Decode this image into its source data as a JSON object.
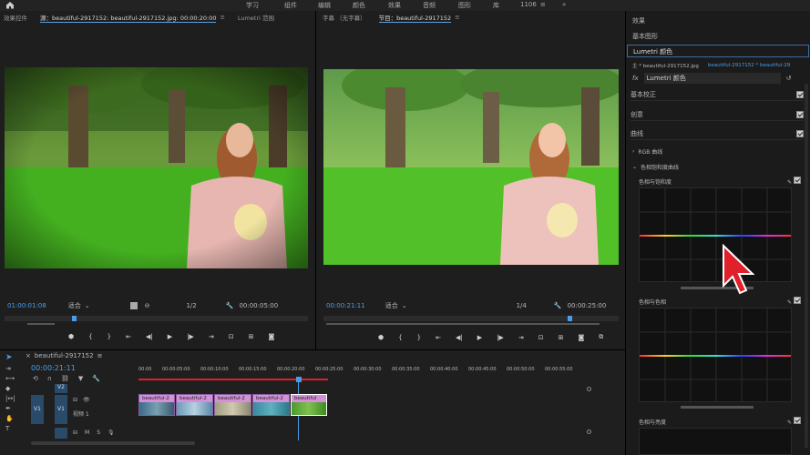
{
  "workspaces": [
    "学习",
    "组件",
    "编辑",
    "颜色",
    "效果",
    "音频",
    "图形",
    "库"
  ],
  "workspace_count": "1106",
  "source_monitor": {
    "tabs": [
      "效果控件",
      "源：beautiful-2917152: beautiful-2917152.jpg: 00:00:20:00",
      "Lumetri 范围"
    ],
    "timecode": "01:00:01:08",
    "fit": "适合",
    "resolution": "1/2",
    "duration": "00:00:05:00"
  },
  "program_monitor": {
    "tabs": [
      "字幕 （无字幕）",
      "节目：beautiful-2917152"
    ],
    "timecode": "00:00:21:11",
    "fit": "适合",
    "resolution": "1/4",
    "duration": "00:00:25:00"
  },
  "right_panel": {
    "effects": "效果",
    "basic_graphics": "基本图形",
    "lumetri_title": "Lumetri 颜色",
    "master_clip": "主 * beautiful-2917152.jpg",
    "seq_clip": "beautiful-2917152 * beautiful-29",
    "fx_name": "Lumetri 颜色",
    "fx_label": "fx",
    "sections": [
      "基本校正",
      "创意",
      "曲线"
    ],
    "rgb_curves": "RGB 曲线",
    "hs_curves": "色相饱和度曲线",
    "curve1": "色相与饱和度",
    "curve2": "色相与色相",
    "curve3": "色相与亮度"
  },
  "timeline": {
    "title": "beautiful-2917152",
    "timecode": "00:00:21:11",
    "ruler": [
      "00:00",
      "00:00:05:00",
      "00:00:10:00",
      "00:00:15:00",
      "00:00:20:00",
      "00:00:25:00",
      "00:00:30:00",
      "00:00:35:00",
      "00:00:40:00",
      "00:00:45:00",
      "00:00:50:00",
      "00:00:55:00",
      "00:01:00:00"
    ],
    "track_v2": "V2",
    "track_v1": "V1",
    "track_v1_name": "视频 1",
    "clips": [
      "beautiful-2",
      "beautiful-2",
      "beautiful-2",
      "beautiful-2",
      "beautiful"
    ],
    "mute": "M",
    "solo": "S"
  },
  "colors": {
    "accent": "#4a9ee8",
    "clip": "#d48fd8",
    "cursor": "#e0202a"
  }
}
